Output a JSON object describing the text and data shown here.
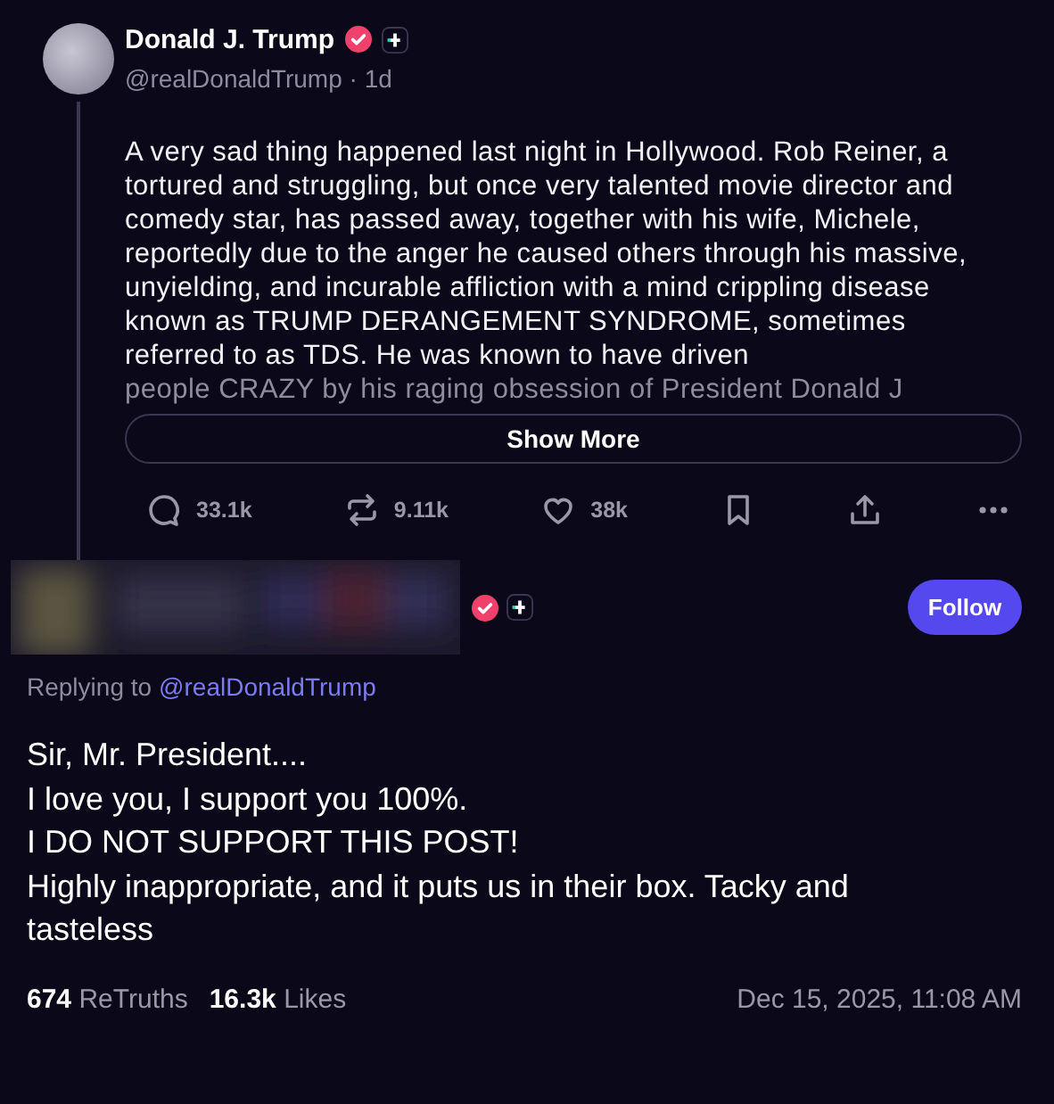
{
  "post": {
    "author": {
      "name": "Donald J. Trump",
      "verified": true,
      "handle": "@realDonaldTrump",
      "separator": "·",
      "time": "1d"
    },
    "text": "A very sad thing happened last night in Hollywood. Rob Reiner, a tortured and struggling, but once very talented movie director and comedy star, has passed away, together with his wife, Michele, reportedly due to the anger he caused others through his massive, unyielding, and incurable affliction with a mind crippling disease known as TRUMP DERANGEMENT SYNDROME, sometimes referred to as TDS. He was known to have driven",
    "faded_text": "people CRAZY by his raging obsession of President Donald J",
    "show_more": "Show More",
    "actions": [
      {
        "kind": "reply",
        "count": "33.1k"
      },
      {
        "kind": "repost",
        "count": "9.11k"
      },
      {
        "kind": "like",
        "count": "38k"
      },
      {
        "kind": "bookmark"
      },
      {
        "kind": "share"
      },
      {
        "kind": "more"
      }
    ]
  },
  "reply": {
    "author": {
      "verified": true
    },
    "follow": "Follow",
    "replying_to": "Replying to",
    "replying_handle": "@realDonaldTrump",
    "lines": [
      "Sir, Mr. President....",
      "I love you, I support you 100%.",
      "I DO NOT SUPPORT THIS POST!",
      "Highly inappropriate, and it puts us in their box. Tacky and tasteless"
    ],
    "stats": [
      {
        "count": "674",
        "label": "ReTruths"
      },
      {
        "count": "16.3k",
        "label": "Likes"
      }
    ],
    "timestamp": "Dec 15, 2025, 11:08 AM"
  }
}
